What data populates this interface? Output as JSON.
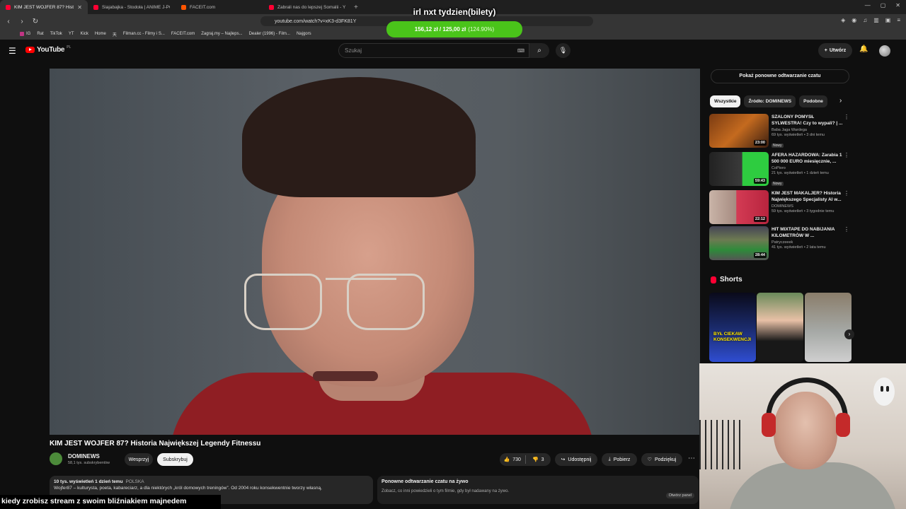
{
  "browser": {
    "tabs": [
      {
        "label": "KIM JEST WOJFER 87? Histo",
        "active": true
      },
      {
        "label": "Siajabajka - Stodoła | ANIME J-POP",
        "active": false
      },
      {
        "label": "FACEIT.com",
        "active": false
      },
      {
        "label": "Zabrali nas do lepszej Somalii - YouTu",
        "active": false
      }
    ],
    "url": "youtube.com/watch?v=xK3-d3FK81Y",
    "bookmarks": [
      "IG",
      "Rat",
      "TikTok",
      "YT",
      "Kick",
      "Home",
      "天",
      "Filman.cc - Filmy i S...",
      "FACEIT.com",
      "Zagraj.my – Najleps...",
      "Dealer (1996) - Film...",
      "Najgors"
    ]
  },
  "overlay": {
    "title": "irl nxt tydzien(bilety)",
    "goal_text": "156,12 zł / 125,00 zł",
    "goal_pct": "(124.90%)",
    "progress": 1.249
  },
  "header": {
    "logo": "YouTube",
    "country": "PL",
    "search_placeholder": "Szukaj",
    "create_label": "Utwórz"
  },
  "video": {
    "title": "KIM JEST WOJFER 87? Historia Największej Legendy Fitnessu",
    "channel": "DOMINEWS",
    "subscribers": "58,1 tys. subskrybentów",
    "support_label": "Wesprzyj",
    "subscribe_label": "Subskrybuj",
    "likes": "730",
    "dislikes": "3",
    "share_label": "Udostępnij",
    "download_label": "Pobierz",
    "thanks_label": "Podziękuj",
    "description_meta": "10 tys. wyświetleń  1 dzień temu",
    "description_tag": "POLSKA",
    "description_text": "Wojfer87 – kulturysta, poeta, kabareciarz, a dla niektórych „król domowych treningów”. Od 2004 roku konsekwentnie tworzy własną,"
  },
  "chat_replay": {
    "button": "Pokaż ponowne odtwarzanie czatu",
    "panel_title": "Ponowne odtwarzanie czatu na żywo",
    "panel_sub": "Zobacz, co inni powiedzieli o tym filmie, gdy był nadawany na żywo.",
    "panel_more": "Otwórz panel"
  },
  "chips": [
    "Wszystkie",
    "Źródło: DOMINEWS",
    "Podobne"
  ],
  "recommendations": [
    {
      "title": "SZALONY POMYSŁ SYLWESTRA! Czy to wypali? | ...",
      "channel": "Baba Jaga Wardega",
      "stats": "69 tys. wyświetleń • 3 dni temu",
      "badge": "Nowy",
      "duration": "23:00"
    },
    {
      "title": "AFERA HAZARDOWA: Zarabia 1 500 000 EURO miesięcznie, ...",
      "channel": "CoPioro",
      "stats": "21 tys. wyświetleń • 1 dzień temu",
      "badge": "Nowy",
      "duration": "59:43"
    },
    {
      "title": "KIM JEST MAKALJER? Historia Największego Specjalisty AI w...",
      "channel": "DOMINEWS",
      "stats": "59 tys. wyświetleń • 3 tygodnie temu",
      "badge": "",
      "duration": "22:12"
    },
    {
      "title": "HIT MIXTAPE DO NABIJANIA KILOMETRÓW W ...",
      "channel": "Patryczeeek",
      "stats": "41 tys. wyświetleń • 2 lata temu",
      "badge": "",
      "duration": "28:44"
    }
  ],
  "shorts": {
    "heading": "Shorts",
    "items": [
      {
        "label": "BYŁ CIEKAW KONSEKWENCJI"
      },
      {
        "label": ""
      },
      {
        "label": ""
      }
    ]
  },
  "stream_caption": "kiedy zrobisz stream z swoim bliźniakiem majnedem",
  "colors": {
    "accent": "#ff0000",
    "goal_bar": "#4ac41a"
  }
}
